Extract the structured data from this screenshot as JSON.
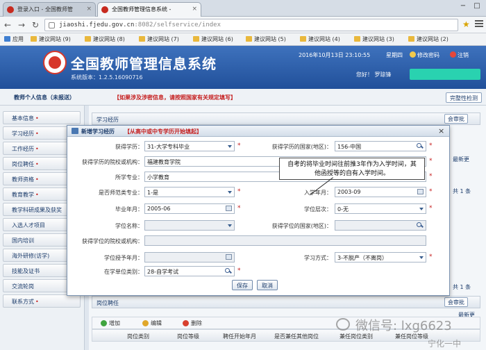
{
  "browser": {
    "tabs": [
      {
        "title": "登录入口 - 全国教师管"
      },
      {
        "title": "全国教师管理信息系统 - "
      }
    ],
    "win_min": "−",
    "win_max": "□",
    "url_host": "jiaoshi.fjedu.gov.cn",
    "url_path": ":8082/selfservice/index",
    "bookmarks": [
      "应用",
      "建议网站 (9)",
      "建议网站 (8)",
      "建议网站 (7)",
      "建议网站 (6)",
      "建议网站 (5)",
      "建议网站 (4)",
      "建议网站 (3)",
      "建议网站 (2)"
    ]
  },
  "header": {
    "title": "全国教师管理信息系统",
    "version": "系统版本：1.2.5.16090716",
    "datetime": "2016年10月13日  23:10:55",
    "weekday": "星期四",
    "change_password": "修改密码",
    "logout": "注销",
    "greeting": "您好！ 罗琼锋"
  },
  "crumb": {
    "title": "教师个人信息（未报送）",
    "warning": "【如果涉及涉密信息，请按照国家有关规定填写】",
    "button": "完整性检测"
  },
  "sidebar": {
    "items": [
      "基本信息",
      "学习经历",
      "工作经历",
      "岗位聘任",
      "教师资格",
      "教育教学",
      "教学科研成果及获奖",
      "入选人才项目",
      "国内培训",
      "海外研修(访学)",
      "技能及证书",
      "交流轮岗",
      "联系方式"
    ],
    "dot": "•"
  },
  "main": {
    "section1": "学习经历",
    "section2": "岗位聘任",
    "audit_btn": "会审批",
    "note1": "最新更",
    "note2": "共 1 条",
    "note3": "最新更",
    "note4": "共 1 条",
    "toolbar": {
      "add": "增加",
      "edit": "编辑",
      "delete": "删除"
    },
    "columns": [
      "岗位类别",
      "岗位等级",
      "聘任开始年月",
      "是否兼任其他岗位",
      "兼任岗位类别",
      "兼任岗位等级"
    ]
  },
  "modal": {
    "title": "新增学习经历",
    "subtitle": "【从高中或中专学历开始填起】",
    "close": "×",
    "fields": {
      "degree_label": "获得学历：",
      "degree_value": "31-大学专科毕业",
      "country_label": "获得学历的国家(地区)：",
      "country_value": "156-中国",
      "school_label": "获得学历的院校或机构：",
      "school_value": "福建教育学院",
      "major_label": "所学专业：",
      "major_value": "小学教育",
      "normal_label": "是否师范类专业：",
      "normal_value": "1-是",
      "enroll_label": "入学年月：",
      "enroll_value": "2003-09",
      "grad_label": "毕业年月：",
      "grad_value": "2005-06",
      "level_label": "学位层次：",
      "level_value": "0-无",
      "degree_name_label": "学位名称：",
      "deg_country_label": "获得学位的国家(地区)：",
      "deg_school_label": "获得学位的院校或机构：",
      "deg_date_label": "学位授予年月：",
      "study_mode_label": "学习方式：",
      "study_mode_value": "3-不脱产（不离岗）",
      "unit_type_label": "在学单位类别：",
      "unit_type_value": "28-自学考试"
    },
    "required_mark": "*",
    "save": "保存",
    "cancel": "取消"
  },
  "annotation": "自考的将毕业时间往前推3年作为入学时间，其他函授等的自有入学时间。",
  "watermark": {
    "text": "微信号: lxg6623",
    "sub": "宁化一中"
  }
}
